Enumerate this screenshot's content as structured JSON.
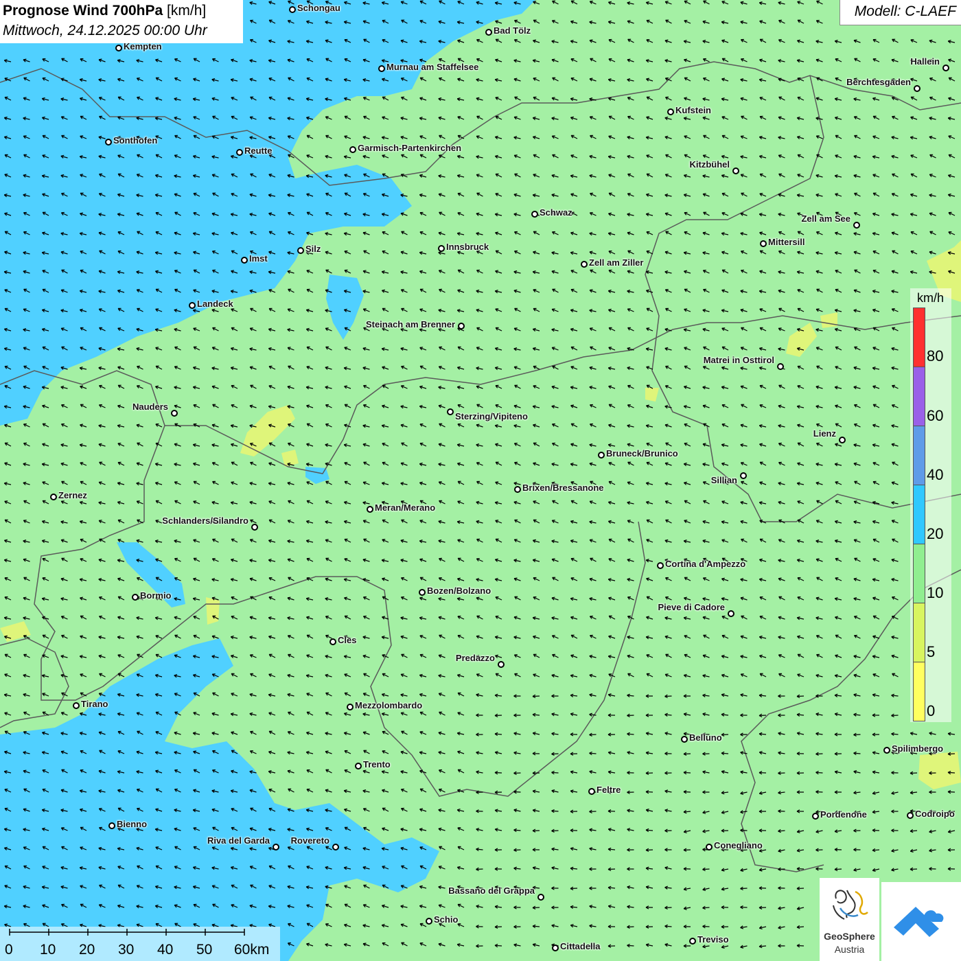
{
  "title": {
    "bold": "Prognose Wind 700hPa",
    "unit": "[km/h]",
    "datetime": "Mittwoch, 24.12.2025 00:00 Uhr"
  },
  "model_label": "Modell: C-LAEF",
  "colors": {
    "green_10_20": "#a4f0a4",
    "blue_20_40": "#50d0ff",
    "yellow_5_10": "#dff57a",
    "arrow": "#000000",
    "border": "#5a5a5a"
  },
  "legend": {
    "unit": "km/h",
    "bands": [
      {
        "label": "80",
        "color": "#ff3030"
      },
      {
        "label": "60",
        "color": "#9a60e8"
      },
      {
        "label": "40",
        "color": "#5f9be8"
      },
      {
        "label": "20",
        "color": "#30c8ff"
      },
      {
        "label": "10",
        "color": "#90ee90"
      },
      {
        "label": "5",
        "color": "#d8f560"
      },
      {
        "label": "0",
        "color": "#ffff60"
      }
    ]
  },
  "wind_direction_arrows": "mostly pointing to south-west (wind from north-east)",
  "cities": [
    {
      "name": "Schongau"
    },
    {
      "name": "Kempten"
    },
    {
      "name": "Bad Tölz"
    },
    {
      "name": "Murnau am Staffelsee"
    },
    {
      "name": "Hallein"
    },
    {
      "name": "Berchtesgaden"
    },
    {
      "name": "Kufstein"
    },
    {
      "name": "Sonthofen"
    },
    {
      "name": "Reutte"
    },
    {
      "name": "Garmisch-Partenkirchen"
    },
    {
      "name": "Kitzbühel"
    },
    {
      "name": "Schwaz"
    },
    {
      "name": "Zell am See"
    },
    {
      "name": "Mittersill"
    },
    {
      "name": "Imst"
    },
    {
      "name": "Silz"
    },
    {
      "name": "Innsbruck"
    },
    {
      "name": "Zell am Ziller"
    },
    {
      "name": "Landeck"
    },
    {
      "name": "Steinach am Brenner"
    },
    {
      "name": "Matrei in Osttirol"
    },
    {
      "name": "Nauders"
    },
    {
      "name": "Sterzing/Vipiteno"
    },
    {
      "name": "Lienz"
    },
    {
      "name": "Bruneck/Brunico"
    },
    {
      "name": "Sillian"
    },
    {
      "name": "Zernez"
    },
    {
      "name": "Brixen/Bressanone"
    },
    {
      "name": "Meran/Merano"
    },
    {
      "name": "Schlanders/Silandro"
    },
    {
      "name": "Cortina d'Ampezzo"
    },
    {
      "name": "Bozen/Bolzano"
    },
    {
      "name": "Bormio"
    },
    {
      "name": "Pieve di Cadore"
    },
    {
      "name": "Cles"
    },
    {
      "name": "Predazzo"
    },
    {
      "name": "Tirano"
    },
    {
      "name": "Mezzolombardo"
    },
    {
      "name": "Belluno"
    },
    {
      "name": "Spilimbergo"
    },
    {
      "name": "Trento"
    },
    {
      "name": "Feltre"
    },
    {
      "name": "Pordenone"
    },
    {
      "name": "Codroipo"
    },
    {
      "name": "Bienno"
    },
    {
      "name": "Riva del Garda"
    },
    {
      "name": "Rovereto"
    },
    {
      "name": "Conegliano"
    },
    {
      "name": "Bassano del Grappa"
    },
    {
      "name": "Schio"
    },
    {
      "name": "Treviso"
    },
    {
      "name": "Cittadella"
    }
  ],
  "scale_bar": {
    "labels": [
      "0",
      "10",
      "20",
      "30",
      "40",
      "50",
      "60km"
    ]
  },
  "logos": {
    "geosphere_name": "GeoSphere",
    "geosphere_sub": "Austria"
  }
}
